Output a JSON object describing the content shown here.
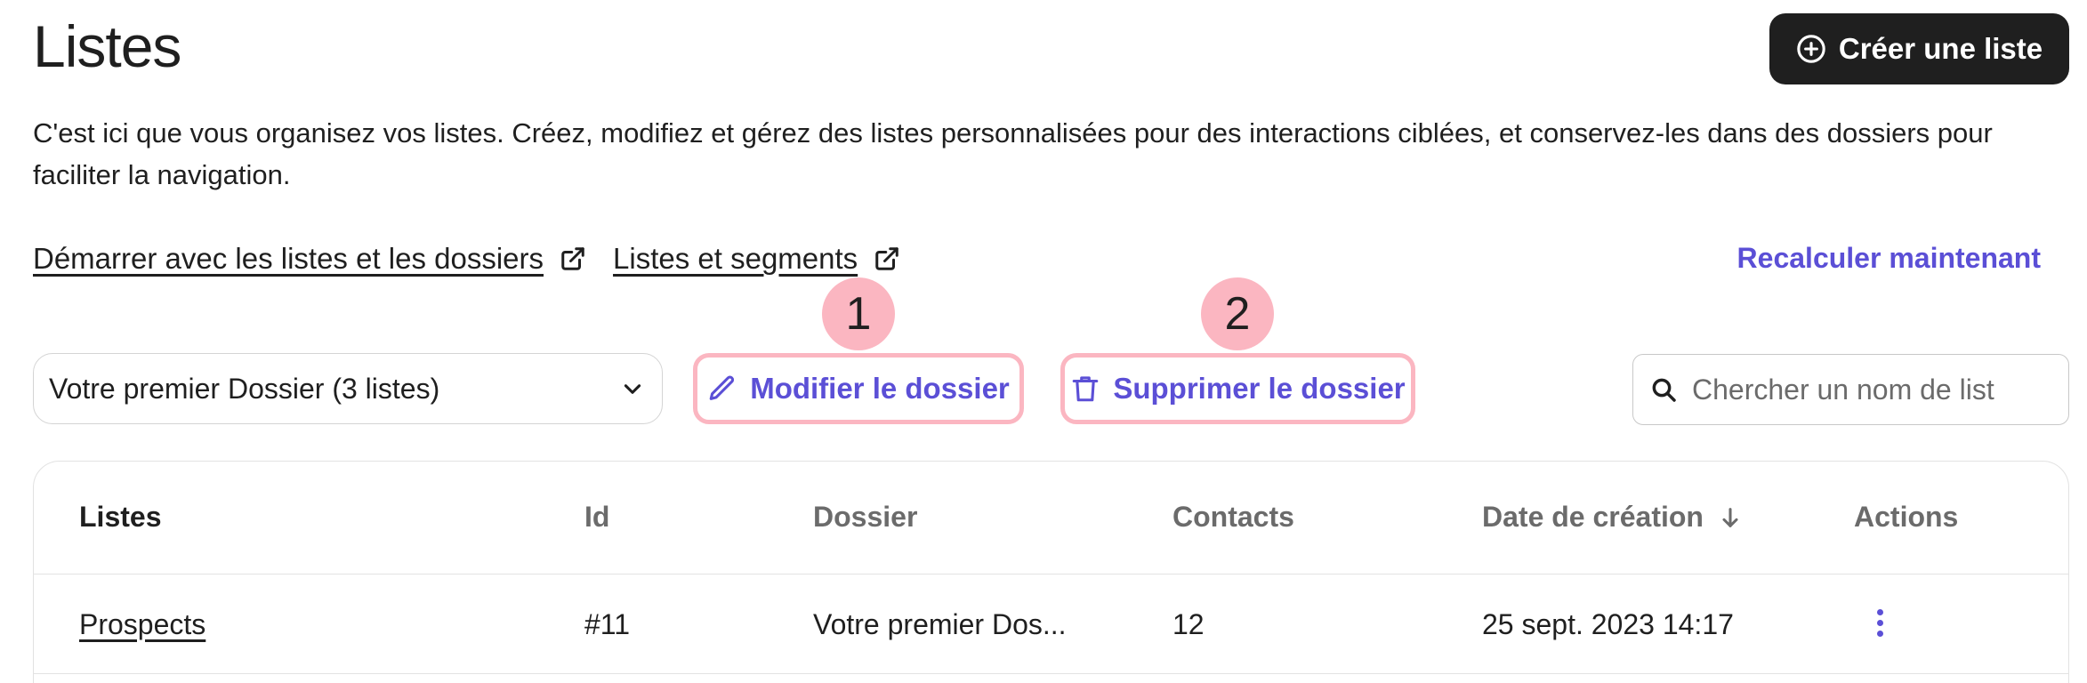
{
  "header": {
    "title": "Listes",
    "create_label": "Créer une liste"
  },
  "description": "C'est ici que vous organisez vos listes. Créez, modifiez et gérez des listes personnalisées pour des interactions ciblées, et conservez-les dans des dossiers pour faciliter la navigation.",
  "help_links": [
    {
      "label": "Démarrer avec les listes et les dossiers",
      "icon": "external-link-icon"
    },
    {
      "label": "Listes et segments",
      "icon": "external-link-icon"
    }
  ],
  "recalculate_label": "Recalculer maintenant",
  "callouts": [
    "1",
    "2"
  ],
  "toolbar": {
    "folder_selected": "Votre premier Dossier (3 listes)",
    "edit_label": "Modifier le dossier",
    "delete_label": "Supprimer le dossier",
    "search_placeholder": "Chercher un nom de list"
  },
  "table": {
    "columns": [
      "Listes",
      "Id",
      "Dossier",
      "Contacts",
      "Date de création",
      "Actions"
    ],
    "rows": [
      {
        "name": "Prospects",
        "id": "#11",
        "folder": "Votre premier Dos...",
        "contacts": "12",
        "created": "25 sept. 2023 14:17"
      }
    ]
  },
  "colors": {
    "accent": "#5b4fd6",
    "highlight": "#fbb6c1",
    "dark_button": "#1f1f1f"
  }
}
